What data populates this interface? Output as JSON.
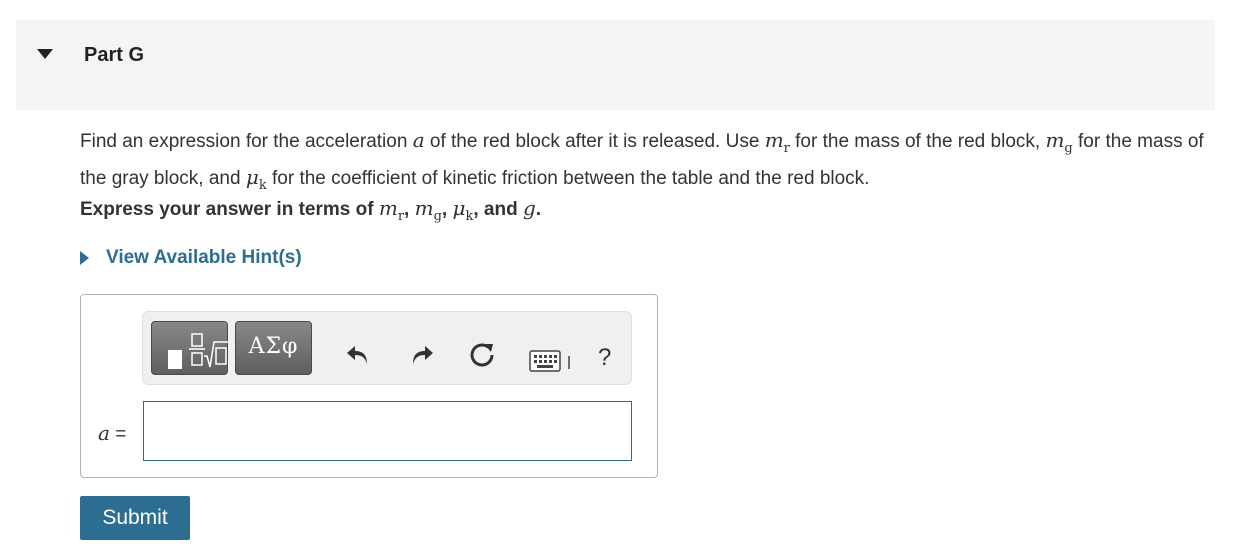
{
  "part": {
    "title": "Part G"
  },
  "question": {
    "seg1": "Find an expression for the acceleration ",
    "var_a": "a",
    "seg2": " of the red block after it is released. Use ",
    "m_r_base": "m",
    "m_r_sub": "r",
    "seg3": " for the mass of the red block, ",
    "m_g_base": "m",
    "m_g_sub": "g",
    "seg4": " for the mass of the gray block, and ",
    "mu_base": "μ",
    "mu_sub": "k",
    "seg5": " for the coefficient of kinetic friction between the table and the red block."
  },
  "instruction": {
    "prefix": "Express your answer in terms of ",
    "m_r_base": "m",
    "m_r_sub": "r",
    "sep1": ", ",
    "m_g_base": "m",
    "m_g_sub": "g",
    "sep2": ", ",
    "mu_base": "μ",
    "mu_sub": "k",
    "sep3": ", and ",
    "g": "g",
    "end": "."
  },
  "hints": {
    "label": "View Available Hint(s)"
  },
  "toolbar": {
    "templates_icon": "fraction-sqrt-template-icon",
    "greek_label": "ΑΣφ",
    "undo_icon": "undo-icon",
    "redo_icon": "redo-icon",
    "reset_icon": "reset-icon",
    "keyboard_icon": "keyboard-icon",
    "help_label": "?"
  },
  "answer": {
    "label_var": "a",
    "label_eq": " =",
    "value": ""
  },
  "submit": {
    "label": "Submit"
  },
  "colors": {
    "accent": "#2c6d91",
    "header_bg": "#f5f5f5",
    "toolbar_button": "#6e6e6e"
  }
}
